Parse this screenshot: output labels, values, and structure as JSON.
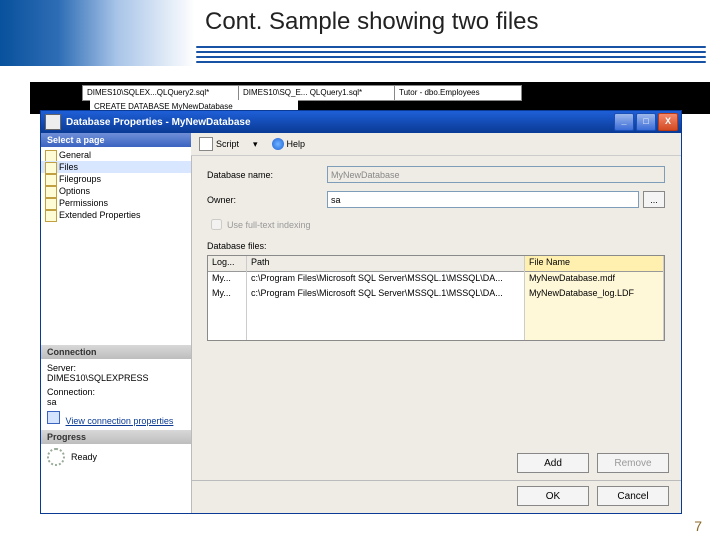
{
  "slide": {
    "title": "Cont. Sample showing two files",
    "page_number": "7"
  },
  "tabs": [
    {
      "label": "DIMES10\\SQLEX...QLQuery2.sql*"
    },
    {
      "label": "DIMES10\\SQ_E... QLQuery1.sql*"
    },
    {
      "label": "Tutor - dbo.Employees"
    }
  ],
  "editor_line": "CREATE  DATABASE  MyNewDatabase",
  "dialog": {
    "title": "Database Properties - MyNewDatabase",
    "toolbar": {
      "script": "Script",
      "help": "Help"
    },
    "nav": {
      "select_page": "Select a page",
      "pages": [
        "General",
        "Files",
        "Filegroups",
        "Options",
        "Permissions",
        "Extended Properties"
      ],
      "selected_index": 1,
      "connection_hdr": "Connection",
      "server_lbl": "Server:",
      "server_val": "DIMES10\\SQLEXPRESS",
      "conn_lbl": "Connection:",
      "conn_val": "sa",
      "view_conn": "View connection properties",
      "progress_hdr": "Progress",
      "progress_val": "Ready"
    },
    "form": {
      "dbname_lbl": "Database name:",
      "dbname_val": "MyNewDatabase",
      "owner_lbl": "Owner:",
      "owner_val": "sa",
      "browse": "...",
      "fulltext_lbl": "Use full-text indexing",
      "files_lbl": "Database files:"
    },
    "grid": {
      "headers": {
        "logical": "Log...",
        "path": "Path",
        "filename": "File Name"
      },
      "rows": [
        {
          "logical": "My...",
          "path": "c:\\Program Files\\Microsoft SQL Server\\MSSQL.1\\MSSQL\\DA...",
          "filename": "MyNewDatabase.mdf"
        },
        {
          "logical": "My...",
          "path": "c:\\Program Files\\Microsoft SQL Server\\MSSQL.1\\MSSQL\\DA...",
          "filename": "MyNewDatabase_log.LDF"
        }
      ]
    },
    "buttons": {
      "add": "Add",
      "remove": "Remove",
      "ok": "OK",
      "cancel": "Cancel"
    }
  }
}
